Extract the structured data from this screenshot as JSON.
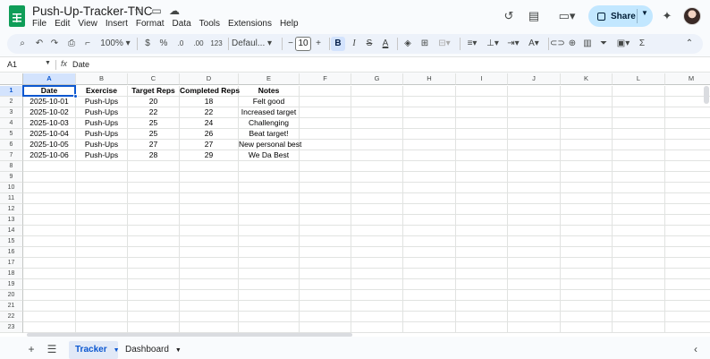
{
  "app": {
    "title": "Push-Up-Tracker-TNC",
    "menu": [
      "File",
      "Edit",
      "View",
      "Insert",
      "Format",
      "Data",
      "Tools",
      "Extensions",
      "Help"
    ],
    "share_label": "Share"
  },
  "toolbar": {
    "zoom": "100%",
    "currency": "$",
    "percent": "%",
    "dec_decrease": ".0",
    "dec_increase": ".00",
    "number_format": "123",
    "font": "Defaul...",
    "font_size": "10",
    "bold": "B",
    "italic": "I",
    "strike": "S",
    "text_color": "A"
  },
  "formula_bar": {
    "name_box": "A1",
    "fx": "fx",
    "content": "Date"
  },
  "grid": {
    "columns": [
      "A",
      "B",
      "C",
      "D",
      "E",
      "F",
      "G",
      "H",
      "I",
      "J",
      "K",
      "L",
      "M"
    ],
    "row_numbers": [
      "1",
      "2",
      "3",
      "4",
      "5",
      "6",
      "7",
      "8",
      "9",
      "10",
      "11",
      "12",
      "13",
      "14",
      "15",
      "16",
      "17",
      "18",
      "19",
      "20",
      "21",
      "22",
      "23"
    ],
    "header": [
      "Date",
      "Exercise",
      "Target Reps",
      "Completed Reps",
      "Notes"
    ],
    "rows": [
      [
        "2025-10-01",
        "Push-Ups",
        "20",
        "18",
        "Felt good"
      ],
      [
        "2025-10-02",
        "Push-Ups",
        "22",
        "22",
        "Increased target"
      ],
      [
        "2025-10-03",
        "Push-Ups",
        "25",
        "24",
        "Challenging"
      ],
      [
        "2025-10-04",
        "Push-Ups",
        "25",
        "26",
        "Beat target!"
      ],
      [
        "2025-10-05",
        "Push-Ups",
        "27",
        "27",
        "New personal best"
      ],
      [
        "2025-10-06",
        "Push-Ups",
        "28",
        "29",
        "We Da Best"
      ]
    ]
  },
  "sheets": [
    {
      "label": "Tracker",
      "active": true
    },
    {
      "label": "Dashboard",
      "active": false
    }
  ],
  "colors": {
    "accent": "#0b57d0",
    "share_bg": "#c2e7ff",
    "logo": "#0f9d58"
  }
}
